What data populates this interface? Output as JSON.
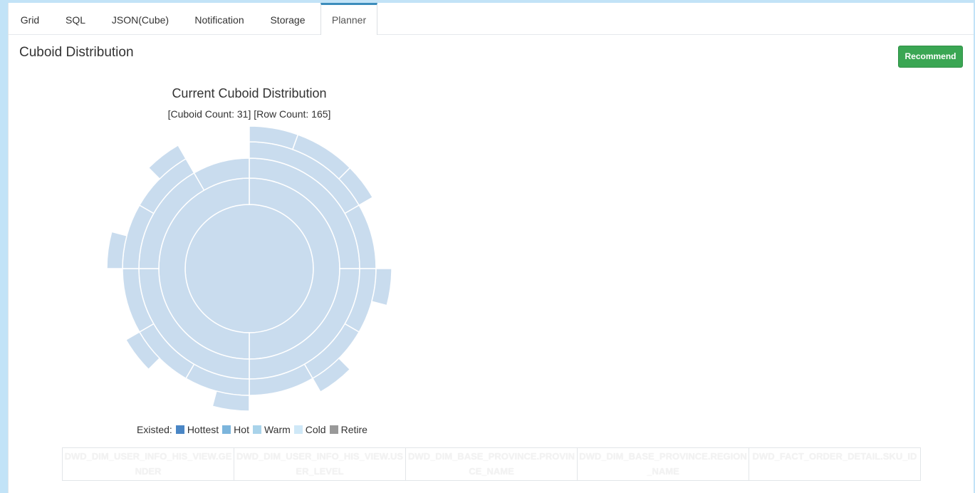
{
  "tabs": [
    {
      "label": "Grid"
    },
    {
      "label": "SQL"
    },
    {
      "label": "JSON(Cube)"
    },
    {
      "label": "Notification"
    },
    {
      "label": "Storage"
    },
    {
      "label": "Planner",
      "active": true
    }
  ],
  "section": {
    "title": "Cuboid Distribution"
  },
  "recommend_button": {
    "label": "Recommend",
    "color": "#3aa653"
  },
  "chart": {
    "title": "Current Cuboid Distribution",
    "subtitle": "[Cuboid Count: 31] [Row Count: 165]",
    "type": "sunburst",
    "cuboid_count": 31,
    "row_count": 165,
    "fill_color": "#c9dcee"
  },
  "legend": {
    "prefix": "Existed:",
    "items": [
      {
        "label": "Hottest",
        "color": "#4a86c5"
      },
      {
        "label": "Hot",
        "color": "#7cb5dc"
      },
      {
        "label": "Warm",
        "color": "#a9d3ea"
      },
      {
        "label": "Cold",
        "color": "#cfe8f7"
      },
      {
        "label": "Retire",
        "color": "#999999"
      }
    ]
  },
  "dimensions": [
    "DWD_DIM_USER_INFO_HIS_VIEW.GENDER",
    "DWD_DIM_USER_INFO_HIS_VIEW.USER_LEVEL",
    "DWD_DIM_BASE_PROVINCE.PROVINCE_NAME",
    "DWD_DIM_BASE_PROVINCE.REGION_NAME",
    "DWD_FACT_ORDER_DETAIL.SKU_ID"
  ]
}
